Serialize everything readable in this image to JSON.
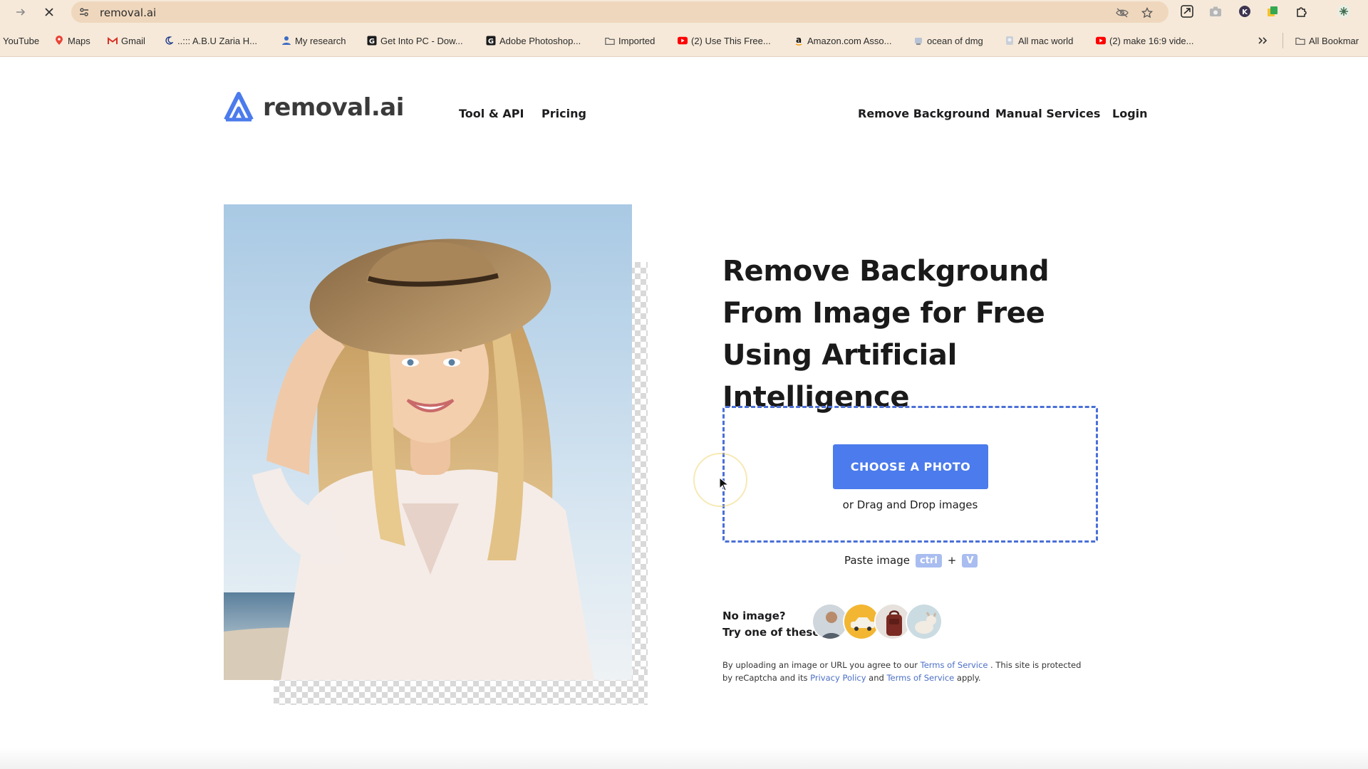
{
  "browser": {
    "url": "removal.ai",
    "bookmarks": [
      {
        "label": "YouTube",
        "icon": "youtube-icon"
      },
      {
        "label": "Maps",
        "icon": "maps-pin-icon"
      },
      {
        "label": "Gmail",
        "icon": "gmail-icon"
      },
      {
        "label": "..::: A.B.U Zaria H...",
        "icon": "moon-icon"
      },
      {
        "label": "My research",
        "icon": "research-icon"
      },
      {
        "label": "Get Into PC - Dow...",
        "icon": "g-icon"
      },
      {
        "label": "Adobe Photoshop...",
        "icon": "g-icon"
      },
      {
        "label": "Imported",
        "icon": "folder-icon"
      },
      {
        "label": "(2) Use This Free...",
        "icon": "youtube-icon"
      },
      {
        "label": "Amazon.com Asso...",
        "icon": "amazon-icon"
      },
      {
        "label": "ocean of dmg",
        "icon": "page-icon"
      },
      {
        "label": "All mac world",
        "icon": "page-icon"
      },
      {
        "label": "(2) make 16:9 vide...",
        "icon": "youtube-icon"
      }
    ],
    "all_bookmarks_label": "All Bookmar"
  },
  "header": {
    "logo_text": "removal.ai",
    "nav_left": [
      "Tool & API",
      "Pricing"
    ],
    "nav_right": [
      "Remove Background",
      "Manual Services",
      "Login"
    ]
  },
  "hero": {
    "headline": "Remove Background From Image for Free Using Artificial Intelligence",
    "choose_button": "CHOOSE A PHOTO",
    "drag_text": "or Drag and Drop images",
    "paste_label": "Paste image",
    "paste_key1": "ctrl",
    "paste_plus": "+",
    "paste_key2": "V",
    "no_image_line1": "No image?",
    "no_image_line2": "Try one of these",
    "samples": [
      "sample-person",
      "sample-car",
      "sample-bag",
      "sample-dog"
    ],
    "legal": {
      "part1": "By uploading an image or URL you agree to our ",
      "terms1": "Terms of Service",
      "part2": " . This site is protected by reCaptcha and its ",
      "privacy": "Privacy Policy",
      "part3": " and ",
      "terms2": "Terms of Service",
      "part4": " apply."
    }
  },
  "colors": {
    "accent": "#4b7bec",
    "chrome": "#f6e9d9",
    "link": "#4b6fc7"
  }
}
